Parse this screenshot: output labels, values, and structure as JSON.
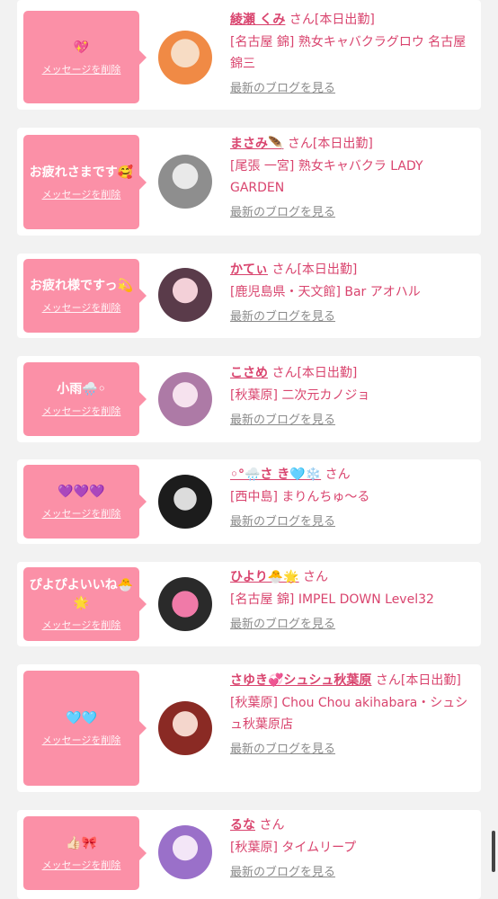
{
  "entries": [
    {
      "message": "💖",
      "delete_label": "メッセージを削除",
      "name": "綾瀬 くみ",
      "honorific": "さん",
      "status": "[本日出勤]",
      "shop": "[名古屋 錦] 熟女キャバクラグロウ 名古屋錦三",
      "blog_label": "最新のブログを見る",
      "avatar_colors": [
        "#f08a45",
        "#f7dcc4"
      ]
    },
    {
      "message": "お疲れさまです🥰",
      "delete_label": "メッセージを削除",
      "name": "まさみ🪶",
      "honorific": "さん",
      "status": "[本日出勤]",
      "shop": "[尾張 一宮] 熟女キャバクラ LADY GARDEN",
      "blog_label": "最新のブログを見る",
      "avatar_colors": [
        "#8e8e8e",
        "#e9e9e9"
      ]
    },
    {
      "message": "お疲れ様ですっ💫",
      "delete_label": "メッセージを削除",
      "name": "かてぃ",
      "honorific": "さん",
      "status": "[本日出勤]",
      "shop": "[鹿児島県・天文館] Bar アオハル",
      "blog_label": "最新のブログを見る",
      "avatar_colors": [
        "#5a3b4a",
        "#f3d0d8"
      ]
    },
    {
      "message": "小雨🌧️◦",
      "delete_label": "メッセージを削除",
      "name": "こさめ",
      "honorific": "さん",
      "status": "[本日出勤]",
      "shop": "[秋葉原] 二次元カノジョ",
      "blog_label": "最新のブログを見る",
      "avatar_colors": [
        "#ad7aa6",
        "#f6e2ee"
      ]
    },
    {
      "message": "💜💜💜",
      "delete_label": "メッセージを削除",
      "name": "◦°🌧️さ き🩵❄️",
      "honorific": "さん",
      "status": "",
      "shop": "[西中島] まりんちゅ～る",
      "blog_label": "最新のブログを見る",
      "avatar_colors": [
        "#1c1c1c",
        "#dcdcdc"
      ]
    },
    {
      "message": "ぴよぴよいいね🐣🌟",
      "delete_label": "メッセージを削除",
      "name": "ひより🐣🌟",
      "honorific": "さん",
      "status": "",
      "shop": "[名古屋 錦] IMPEL DOWN Level32",
      "blog_label": "最新のブログを見る",
      "avatar_colors": [
        "#2a2a2a",
        "#f07aa8"
      ]
    },
    {
      "message": "🩵🩵",
      "delete_label": "メッセージを削除",
      "name": "さゆき💞シュシュ秋葉原",
      "honorific": "さん",
      "status": "[本日出勤]",
      "shop": "[秋葉原] Chou Chou akihabara・シュシュ秋葉原店",
      "blog_label": "最新のブログを見る",
      "avatar_colors": [
        "#8a2a24",
        "#f4d6cc"
      ]
    },
    {
      "message": "👍🏻🎀",
      "delete_label": "メッセージを削除",
      "name": "るな",
      "honorific": "さん",
      "status": "",
      "shop": "[秋葉原] タイムリープ",
      "blog_label": "最新のブログを見る",
      "avatar_colors": [
        "#9a70c9",
        "#f3e6f7"
      ]
    }
  ]
}
